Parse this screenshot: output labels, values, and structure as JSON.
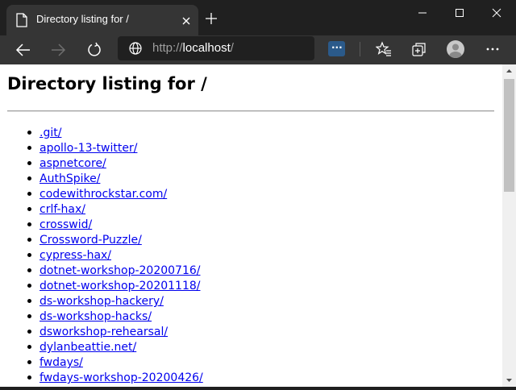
{
  "tab": {
    "title": "Directory listing for /"
  },
  "address": {
    "scheme": "http://",
    "host": "localhost",
    "path": "/"
  },
  "page": {
    "title": "Directory listing for /",
    "entries": [
      ".git/",
      "apollo-13-twitter/",
      "aspnetcore/",
      "AuthSpike/",
      "codewithrockstar.com/",
      "crlf-hax/",
      "crosswid/",
      "Crossword-Puzzle/",
      "cypress-hax/",
      "dotnet-workshop-20200716/",
      "dotnet-workshop-20201118/",
      "ds-workshop-hackery/",
      "ds-workshop-hacks/",
      "dsworkshop-rehearsal/",
      "dylanbeattie.net/",
      "fwdays/",
      "fwdays-workshop-20200426/"
    ]
  },
  "colors": {
    "link": "#0000ee",
    "tab_active": "#353535",
    "titlebar": "#202020"
  },
  "icons": [
    "document-icon",
    "close-icon",
    "plus-icon",
    "minimize-icon",
    "maximize-icon",
    "back-icon",
    "forward-icon",
    "refresh-icon",
    "globe-icon",
    "reader-mode-icon",
    "favorites-icon",
    "collections-icon",
    "profile-icon",
    "more-icon"
  ]
}
